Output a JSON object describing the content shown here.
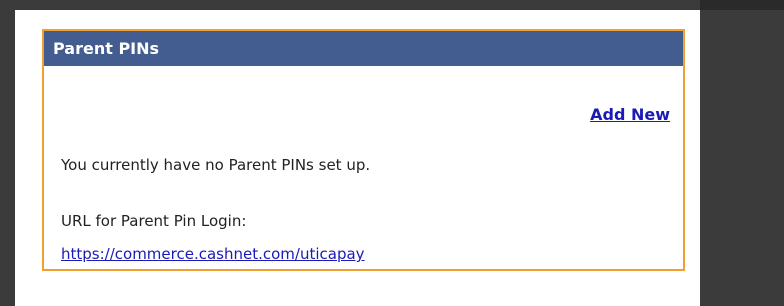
{
  "panel": {
    "title": "Parent PINs",
    "add_new_label": "Add New",
    "no_pins_message": "You currently have no Parent PINs set up.",
    "url_label": "URL for Parent Pin Login:",
    "url_link": "https://commerce.cashnet.com/uticapay"
  },
  "colors": {
    "header_bg": "#435d91",
    "panel_border": "#f0a030",
    "link": "#1a1ab8"
  }
}
